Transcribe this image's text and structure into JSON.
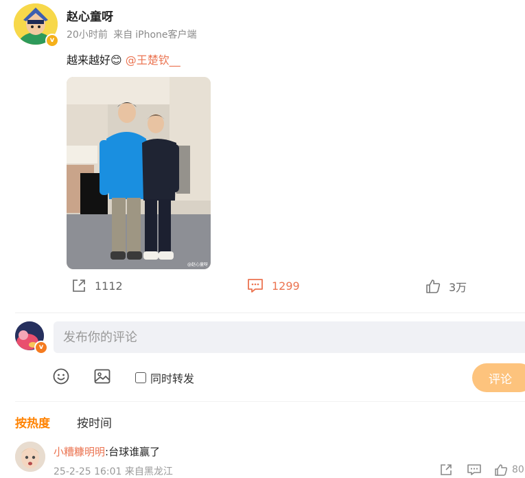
{
  "post": {
    "username": "赵心童呀",
    "time": "20小时前",
    "source_prefix": "来自",
    "source": "iPhone客户端",
    "text": "越来越好",
    "emoji": "😊",
    "mention": "@王楚钦__",
    "watermark": "@赵心童呀"
  },
  "actions": {
    "repost_count": "1112",
    "comment_count": "1299",
    "like_count": "3万"
  },
  "composer": {
    "placeholder": "发布你的评论",
    "repost_label": "同时转发",
    "submit_label": "评论"
  },
  "sort": {
    "hot_label": "按热度",
    "time_label": "按时间"
  },
  "comments": [
    {
      "user": "小糟糠明明",
      "sep": ":",
      "text": "台球谁赢了",
      "date": "25-2-25 16:01",
      "source": "来自黑龙江",
      "like_count": "80"
    }
  ],
  "colors": {
    "accent": "#eb7350",
    "hot_tab": "#ff8200",
    "submit_bg": "#fdc37d",
    "input_bg": "#f0f1f5"
  }
}
